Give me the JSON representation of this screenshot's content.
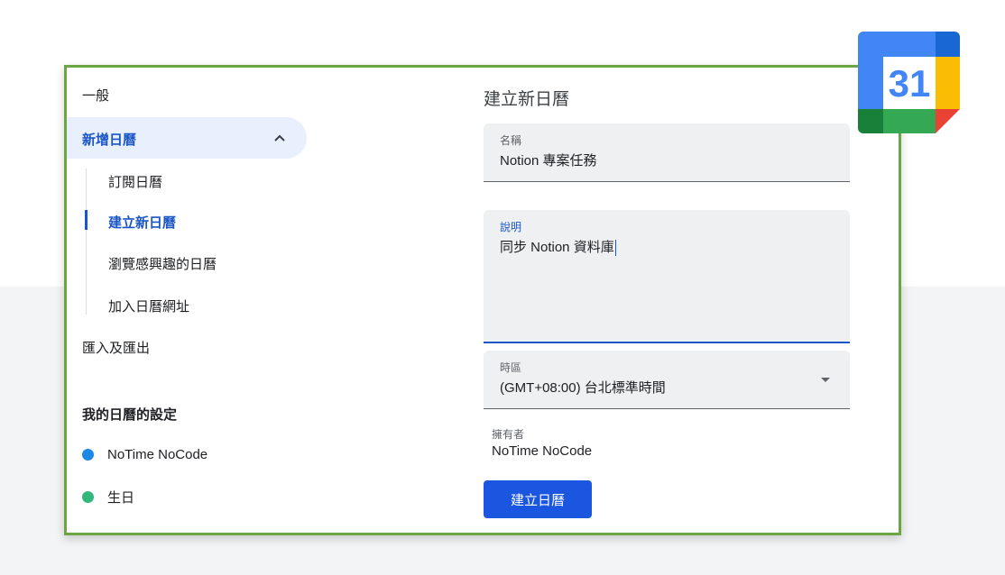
{
  "nav": {
    "general": "一般",
    "add_calendar": "新增日曆",
    "sub_items": [
      "訂閱日曆",
      "建立新日曆",
      "瀏覽感興趣的日曆",
      "加入日曆網址"
    ],
    "import_export": "匯入及匯出",
    "my_calendars_heading": "我的日曆的設定",
    "calendars": [
      {
        "name": "NoTime NoCode",
        "color": "#1e88e5"
      },
      {
        "name": "生日",
        "color": "#33b679"
      }
    ]
  },
  "form": {
    "title": "建立新日曆",
    "name": {
      "label": "名稱",
      "value": "Notion 專案任務"
    },
    "description": {
      "label": "說明",
      "value": "同步 Notion 資料庫"
    },
    "timezone": {
      "label": "時區",
      "value": "(GMT+08:00) 台北標準時間"
    },
    "owner": {
      "label": "擁有者",
      "value": "NoTime NoCode"
    },
    "submit_label": "建立日曆"
  },
  "logo": {
    "day_number": "31",
    "icon": "google-calendar-logo"
  },
  "colors": {
    "accent": "#1a56c6",
    "button": "#1a56e0",
    "panel_border": "#6aa641"
  }
}
